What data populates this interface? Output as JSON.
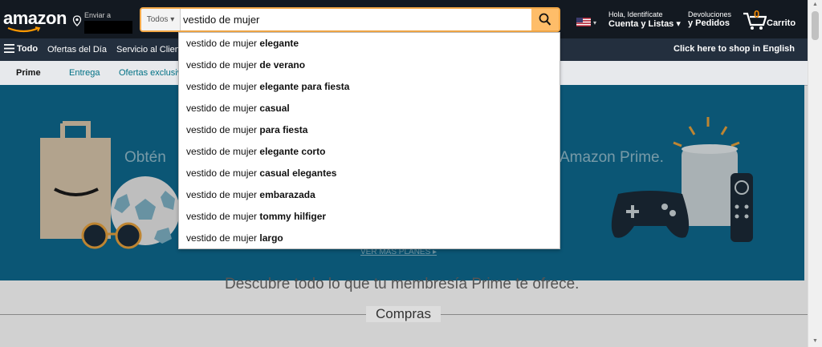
{
  "header": {
    "logo": "amazon",
    "deliver_label": "Enviar a",
    "search_category": "Todos ▾",
    "search_value": "vestido de mujer",
    "account_line1": "Hola, Identifícate",
    "account_line2": "Cuenta y Listas ▾",
    "orders_line1": "Devoluciones",
    "orders_line2": "y Pedidos",
    "cart_count": "0",
    "cart_label": "Carrito",
    "flag_caret": "▾"
  },
  "nav": {
    "all_label": "Todo",
    "links": [
      "Ofertas del Día",
      "Servicio al Cliente"
    ],
    "english_link": "Click here to shop in English"
  },
  "subnav": {
    "items": [
      "Prime",
      "Entrega",
      "Ofertas exclusivas"
    ]
  },
  "banner": {
    "left_text": "Obtén",
    "right_text": "Amazon Prime.",
    "more_link": "VER MÁS PLANES ▸"
  },
  "below": {
    "partial_text": "Descubre todo lo que tu membresía Prime te ofrece.",
    "section_title": "Compras"
  },
  "suggestions": [
    {
      "prefix": "vestido de mujer ",
      "suffix": "elegante"
    },
    {
      "prefix": "vestido de mujer ",
      "suffix": "de verano"
    },
    {
      "prefix": "vestido de mujer ",
      "suffix": "elegante para fiesta"
    },
    {
      "prefix": "vestido de mujer ",
      "suffix": "casual"
    },
    {
      "prefix": "vestido de mujer ",
      "suffix": "para fiesta"
    },
    {
      "prefix": "vestido de mujer ",
      "suffix": "elegante corto"
    },
    {
      "prefix": "vestido de mujer ",
      "suffix": "casual elegantes"
    },
    {
      "prefix": "vestido de mujer ",
      "suffix": "embarazada"
    },
    {
      "prefix": "vestido de mujer ",
      "suffix": "tommy hilfiger"
    },
    {
      "prefix": "vestido de mujer ",
      "suffix": "largo"
    }
  ],
  "colors": {
    "nav_dark": "#131921",
    "nav_main": "#232f3e",
    "search_button": "#febd69",
    "cart_count": "#f08804",
    "banner": "#0e6a8f"
  },
  "icons": [
    "location-pin-icon",
    "search-icon",
    "us-flag-icon",
    "cart-icon",
    "hamburger-menu-icon"
  ]
}
